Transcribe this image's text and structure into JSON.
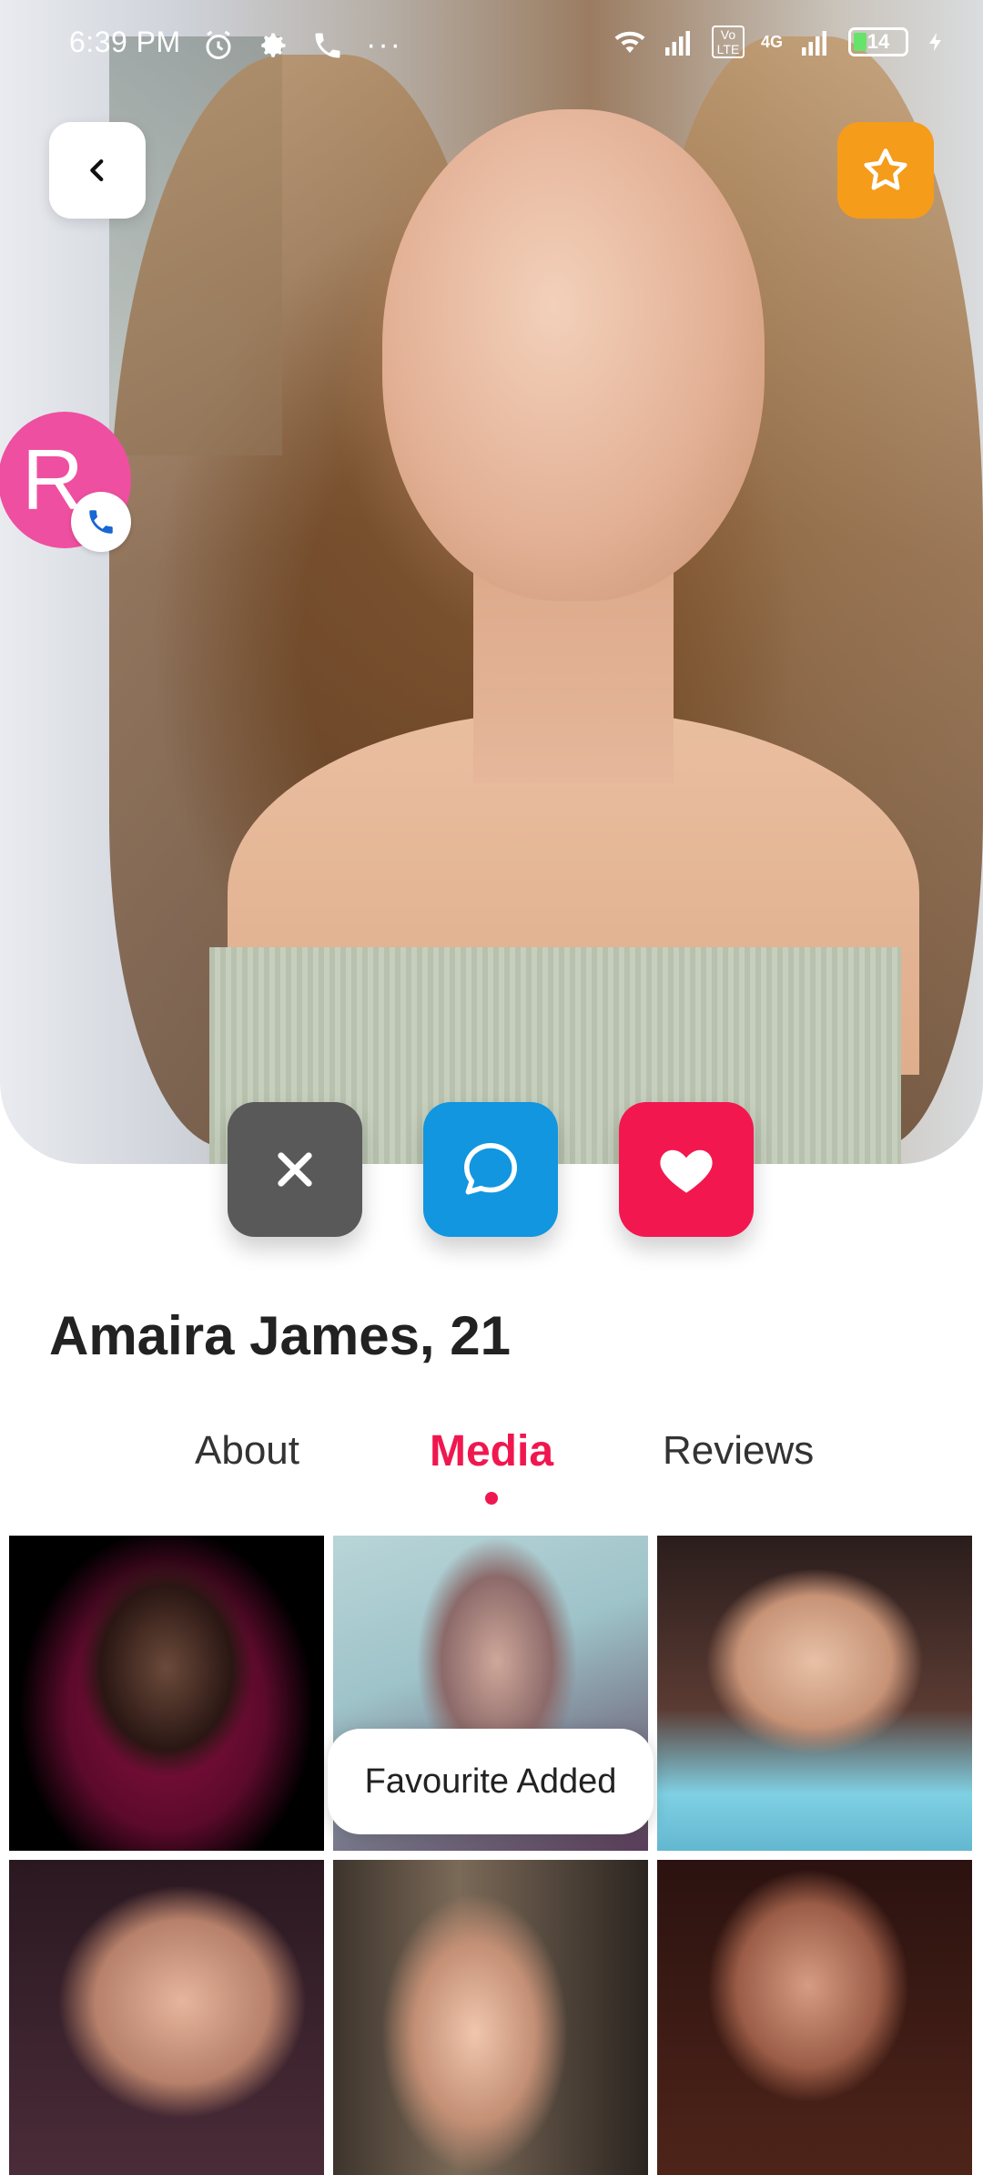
{
  "status_bar": {
    "time": "6:39 PM",
    "battery": "14",
    "network": "4G",
    "volte": "Vo LTE"
  },
  "profile": {
    "avatar_initial": "R",
    "name_age": "Amaira James, 21"
  },
  "tabs": [
    {
      "label": "About",
      "active": false
    },
    {
      "label": "Media",
      "active": true
    },
    {
      "label": "Reviews",
      "active": false
    }
  ],
  "toast": {
    "message": "Favourite Added"
  },
  "colors": {
    "accent": "#f0174f",
    "favorite": "#f59c1b",
    "chat": "#1196df",
    "reject": "#595959",
    "avatar": "#ef4fa0"
  },
  "icons": {
    "back": "chevron-left-icon",
    "favorite": "star-icon",
    "reject": "close-icon",
    "chat": "chat-bubble-icon",
    "like": "heart-icon",
    "call": "phone-icon"
  }
}
